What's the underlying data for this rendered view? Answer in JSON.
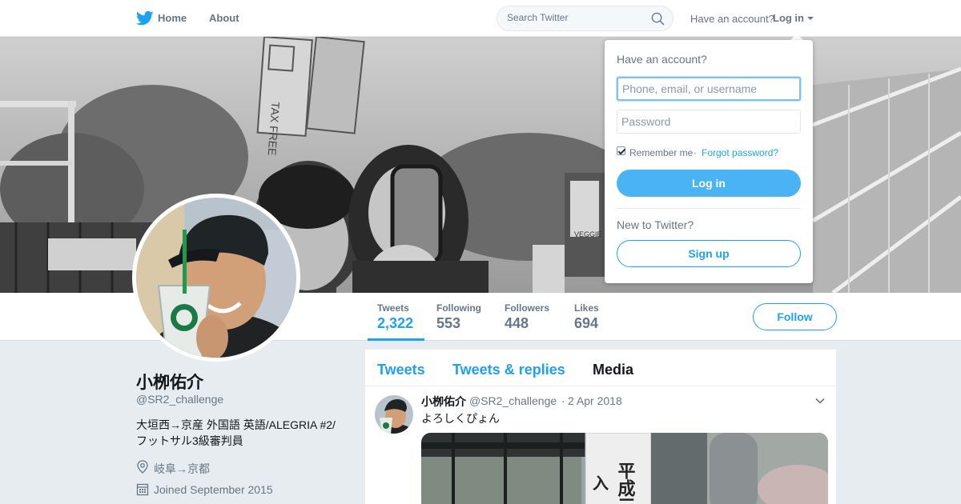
{
  "topbar": {
    "home_label": "Home",
    "about_label": "About",
    "search_placeholder": "Search Twitter",
    "have_account": "Have an account?",
    "login_label": "Log in"
  },
  "profile": {
    "name": "小栁佑介",
    "handle": "@SR2_challenge",
    "bio": "大垣西→京産 外国語 英語/ALEGRIA #2/フットサル3級審判員",
    "location": "岐阜→京都",
    "joined": "Joined September 2015"
  },
  "stats": [
    {
      "label": "Tweets",
      "value": "2,322",
      "active": true
    },
    {
      "label": "Following",
      "value": "553"
    },
    {
      "label": "Followers",
      "value": "448"
    },
    {
      "label": "Likes",
      "value": "694"
    }
  ],
  "follow_label": "Follow",
  "timeline": {
    "tabs": [
      {
        "label": "Tweets"
      },
      {
        "label": "Tweets & replies"
      },
      {
        "label": "Media",
        "active": true
      }
    ],
    "tweet": {
      "author": "小栁佑介",
      "handle": "@SR2_challenge",
      "separator": "·",
      "date": "2 Apr 2018",
      "text": "よろしくぴょん",
      "media_text_1": "平成三",
      "media_text_2": "入"
    }
  },
  "login_dropdown": {
    "title": "Have an account?",
    "username_placeholder": "Phone, email, or username",
    "password_placeholder": "Password",
    "remember_label": "Remember me",
    "separator": "·",
    "forgot_label": "Forgot password?",
    "login_button": "Log in",
    "new_label": "New to Twitter?",
    "signup_button": "Sign up"
  },
  "banner": {
    "sign_text_1": "TAX FREE",
    "sign_text_2": "VEGGIE"
  },
  "colors": {
    "accent": "#1da1f2",
    "login_button": "#4ab3f4",
    "background": "#e6ecf0"
  }
}
